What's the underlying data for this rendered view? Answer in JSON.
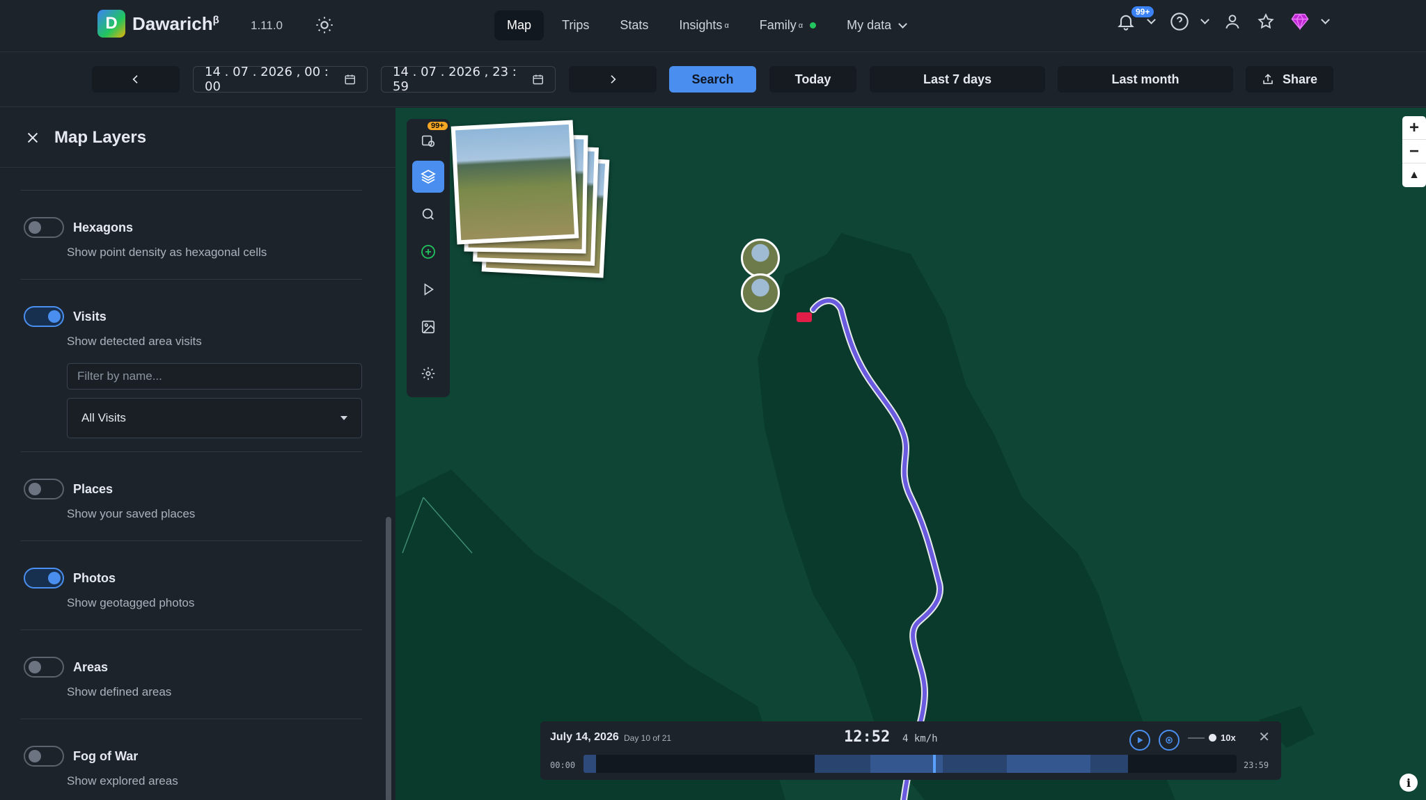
{
  "app": {
    "name": "Dawarich",
    "superscript": "β",
    "version": "1.11.0"
  },
  "nav": {
    "items": [
      {
        "label": "Map",
        "sup": ""
      },
      {
        "label": "Trips",
        "sup": ""
      },
      {
        "label": "Stats",
        "sup": ""
      },
      {
        "label": "Insights",
        "sup": "α"
      },
      {
        "label": "Family",
        "sup": "α"
      },
      {
        "label": "My data",
        "sup": ""
      }
    ],
    "notifications_badge": "99+"
  },
  "datebar": {
    "start": "14 . 07 . 2026 ,  00 : 00",
    "end": "14 . 07 . 2026 ,  23 : 59",
    "search": "Search",
    "today": "Today",
    "last7": "Last 7 days",
    "lastmonth": "Last month",
    "share": "Share"
  },
  "panel": {
    "title": "Map Layers",
    "layers": [
      {
        "name": "Hexagons",
        "desc": "Show point density as hexagonal cells",
        "on": false
      },
      {
        "name": "Visits",
        "desc": "Show detected area visits",
        "on": true,
        "filter_placeholder": "Filter by name...",
        "select_value": "All Visits"
      },
      {
        "name": "Places",
        "desc": "Show your saved places",
        "on": false
      },
      {
        "name": "Photos",
        "desc": "Show geotagged photos",
        "on": true
      },
      {
        "name": "Areas",
        "desc": "Show defined areas",
        "on": false
      },
      {
        "name": "Fog of War",
        "desc": "Show explored areas",
        "on": false
      }
    ]
  },
  "map": {
    "toolbar_badge": "99+",
    "timeline": {
      "date": "July 14, 2026",
      "day": "Day 10 of 21",
      "time": "12:52",
      "speed": "4 km/h",
      "start": "00:00",
      "end": "23:59",
      "playback": "10x",
      "position": 0.535
    }
  },
  "colors": {
    "accent": "#4a8ff0",
    "map_bg": "#0e4535",
    "land": "#0a3a2c"
  }
}
